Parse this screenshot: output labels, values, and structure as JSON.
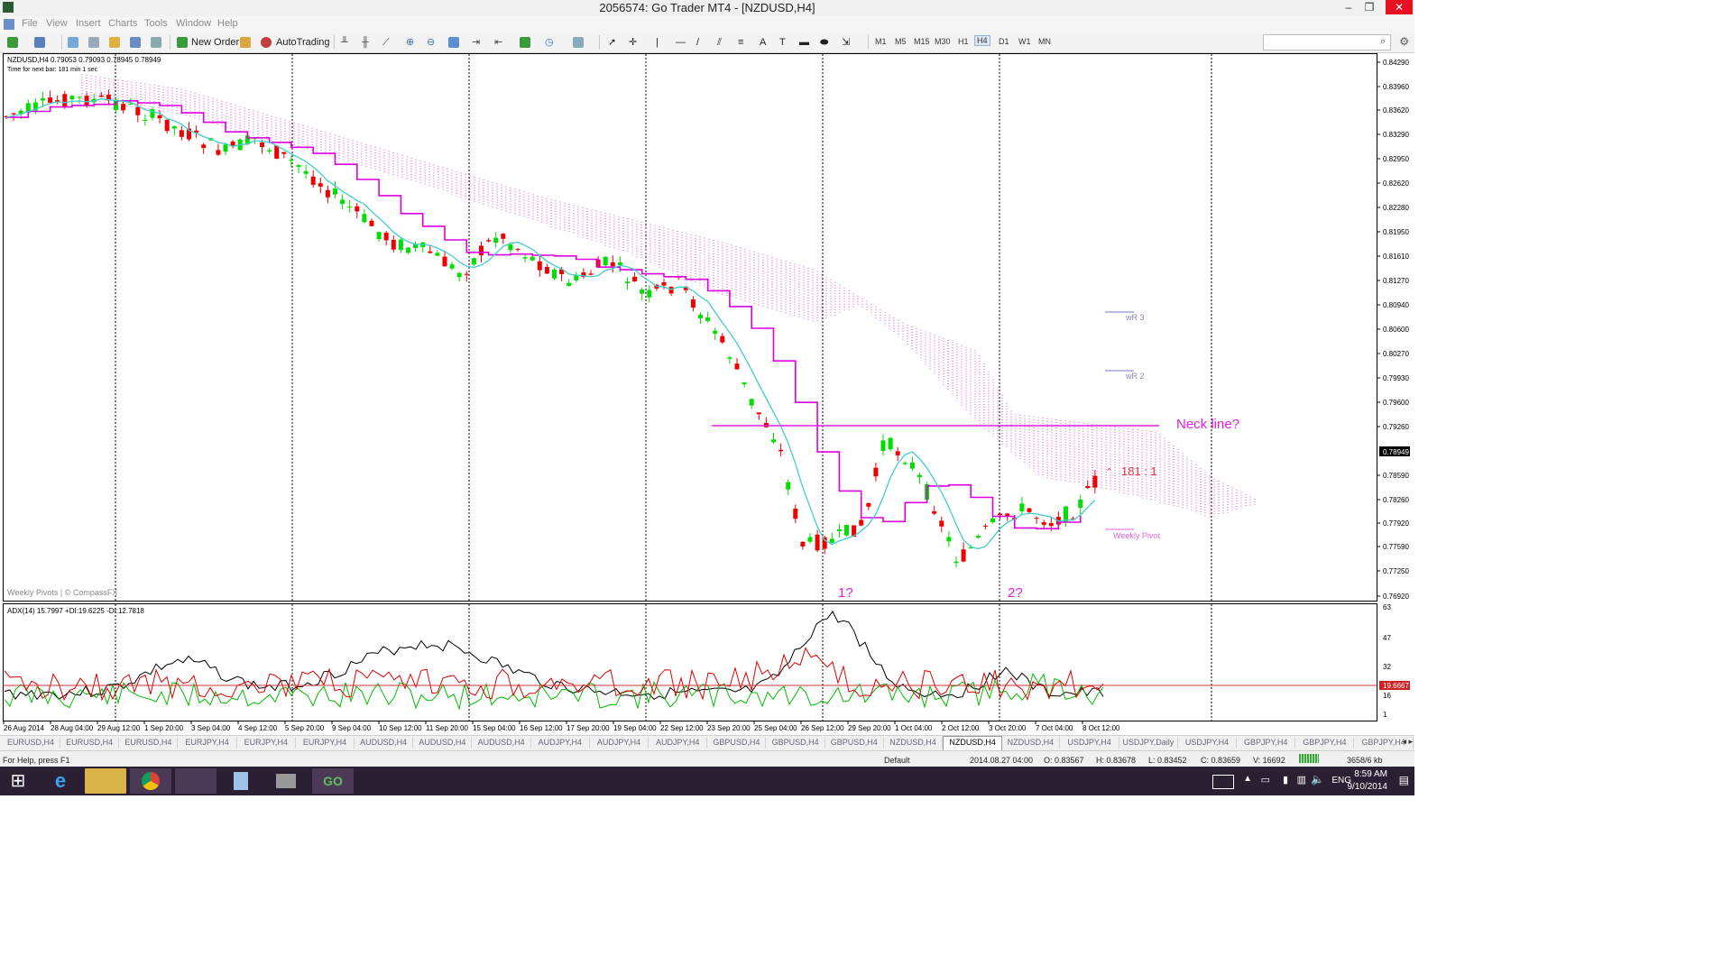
{
  "window": {
    "title": "2056574: Go Trader MT4 - [NZDUSD,H4]"
  },
  "menu": [
    "File",
    "View",
    "Insert",
    "Charts",
    "Tools",
    "Window",
    "Help"
  ],
  "toolbar": {
    "new_order": "New Order",
    "autotrading": "AutoTrading",
    "timeframes": [
      "M1",
      "M5",
      "M15",
      "M30",
      "H1",
      "H4",
      "D1",
      "W1",
      "MN"
    ],
    "active_timeframe": "H4"
  },
  "chart": {
    "symbol_line": "NZDUSD,H4  0.79053 0.79093 0.78945 0.78949",
    "timer_line": "Time for next bar: 181 min 1 sec",
    "watermark": "Weekly Pivots | © CompassFX",
    "price_labels": [
      "0.84290",
      "0.83960",
      "0.83620",
      "0.83290",
      "0.82950",
      "0.82620",
      "0.82280",
      "0.81950",
      "0.81610",
      "0.81270",
      "0.80940",
      "0.80600",
      "0.80270",
      "0.79930",
      "0.79600",
      "0.79260",
      "0.78949",
      "0.78590",
      "0.78260",
      "0.77920",
      "0.77590",
      "0.77250",
      "0.76920"
    ],
    "current_price": "0.78949",
    "annotations": {
      "neckline": "Neck line?",
      "ratio": "181 : 1",
      "bottom1": "1?",
      "bottom2": "2?",
      "wr3": "wR 3",
      "wr2": "wR 2",
      "weekly_pivot": "Weekly Pivot"
    },
    "colors": {
      "bull": "#00dd00",
      "bear": "#ee0000",
      "kijun": "#dd00dd",
      "tenkan": "#44cccc",
      "cloud": "#dd44dd",
      "annotation": "#e020e0"
    }
  },
  "indicator": {
    "label": "ADX(14) 15.7997 +DI:19.6225 -DI:12.7818",
    "scale": [
      "63",
      "47",
      "32",
      "16",
      "1"
    ],
    "current": "19.6667"
  },
  "time_labels": [
    "26 Aug 2014",
    "28 Aug 04:00",
    "29 Aug 12:00",
    "1 Sep 20:00",
    "3 Sep 04:00",
    "4 Sep 12:00",
    "5 Sep 20:00",
    "9 Sep 04:00",
    "10 Sep 12:00",
    "11 Sep 20:00",
    "15 Sep 04:00",
    "16 Sep 12:00",
    "17 Sep 20:00",
    "19 Sep 04:00",
    "22 Sep 12:00",
    "23 Sep 20:00",
    "25 Sep 04:00",
    "26 Sep 12:00",
    "29 Sep 20:00",
    "1 Oct 04:00",
    "2 Oct 12:00",
    "3 Oct 20:00",
    "7 Oct 04:00",
    "8 Oct 12:00"
  ],
  "tabs": [
    "EURUSD,H4",
    "EURUSD,H4",
    "EURUSD,H4",
    "EURJPY,H4",
    "EURJPY,H4",
    "EURJPY,H4",
    "AUDUSD,H4",
    "AUDUSD,H4",
    "AUDUSD,H4",
    "AUDJPY,H4",
    "AUDJPY,H4",
    "AUDJPY,H4",
    "GBPUSD,H4",
    "GBPUSD,H4",
    "GBPUSD,H4",
    "NZDUSD,H4",
    "NZDUSD,H4",
    "NZDUSD,H4",
    "USDJPY,H4",
    "USDJPY,Daily",
    "USDJPY,H4",
    "GBPJPY,H4",
    "GBPJPY,H4",
    "GBPJPY,H4"
  ],
  "active_tab": 16,
  "status": {
    "help": "For Help, press F1",
    "profile": "Default",
    "datetime": "2014.08.27 04:00",
    "open": "O: 0.83567",
    "high": "H: 0.83678",
    "low": "L: 0.83452",
    "close": "C: 0.83659",
    "volume": "V: 16692",
    "traffic": "3658/6 kb"
  },
  "taskbar": {
    "lang": "ENG",
    "time": "8:59 AM",
    "date": "9/10/2014"
  }
}
